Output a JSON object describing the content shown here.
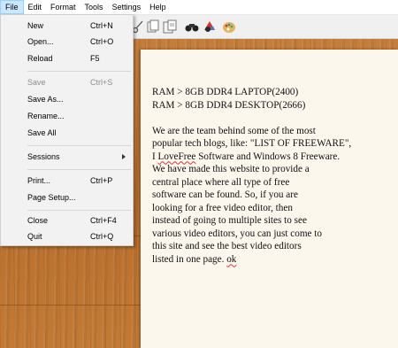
{
  "menubar": [
    "File",
    "Edit",
    "Format",
    "Tools",
    "Settings",
    "Help"
  ],
  "file_menu": {
    "new": {
      "label": "New",
      "shortcut": "Ctrl+N"
    },
    "open": {
      "label": "Open...",
      "shortcut": "Ctrl+O"
    },
    "reload": {
      "label": "Reload",
      "shortcut": "F5"
    },
    "save": {
      "label": "Save",
      "shortcut": "Ctrl+S"
    },
    "save_as": {
      "label": "Save As..."
    },
    "rename": {
      "label": "Rename..."
    },
    "save_all": {
      "label": "Save All"
    },
    "sessions": {
      "label": "Sessions"
    },
    "print": {
      "label": "Print...",
      "shortcut": "Ctrl+P"
    },
    "page_setup": {
      "label": "Page Setup..."
    },
    "close": {
      "label": "Close",
      "shortcut": "Ctrl+F4"
    },
    "quit": {
      "label": "Quit",
      "shortcut": "Ctrl+Q"
    }
  },
  "document": {
    "lines_top": [
      "RAM > 8GB DDR4 LAPTOP(2400)",
      "RAM > 8GB DDR4 DESKTOP(2666)"
    ],
    "paragraph": [
      "We are the team behind some of the most",
      "popular tech blogs, like: \"LIST OF FREEWARE\",",
      "I |LoveFree| Software and Windows 8 Freeware.",
      "We have made this website to provide a",
      "central place where all type of free",
      "software can be found. So, if you are",
      "looking for a free video editor, then",
      "instead of going to multiple sites to see",
      "various video editors, you can just come to",
      "this site and see the best video editors",
      "listed in one page. |ok|"
    ]
  },
  "colors": {
    "menu_highlight": "#cce8ff",
    "paper": "#fbf7ec",
    "desk": "#c27a36"
  }
}
